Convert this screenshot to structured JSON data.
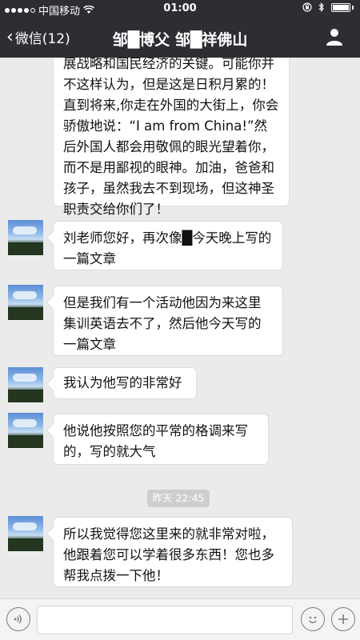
{
  "status_bar": {
    "carrier": "中国移动",
    "time": "01:00"
  },
  "nav": {
    "back_label": "微信(12)",
    "title": "邹█博父 邹█祥佛山"
  },
  "messages": [
    {
      "text": "展战略和国民经济的关键。可能你并不这样认为，但是这是日积月累的！直到将来,你走在外国的大街上，你会骄傲地说：“I am from China!”然后外国人都会用敬佩的眼光望着你，而不是用鄙视的眼神。加油，爸爸和孩子，虽然我去不到现场，但这神圣职责交给你们了！"
    },
    {
      "text": "刘老师您好，再次像█今天晚上写的一篇文章"
    },
    {
      "text": "但是我们有一个活动他因为来这里集训英语去不了，然后他今天写的一篇文章"
    },
    {
      "text": "我认为他写的非常好"
    },
    {
      "text": "他说他按照您的平常的格调来写的，写的就大气"
    },
    {
      "text": "所以我觉得您这里来的就非常对啦，他跟着您可以学着很多东西！您也多帮我点拨一下他！"
    }
  ],
  "timestamp": "昨天 22:45",
  "icons": {
    "back": "chevron-left-icon",
    "profile": "person-icon",
    "voice": "voice-icon",
    "emoji": "emoji-icon",
    "plus": "plus-icon"
  }
}
